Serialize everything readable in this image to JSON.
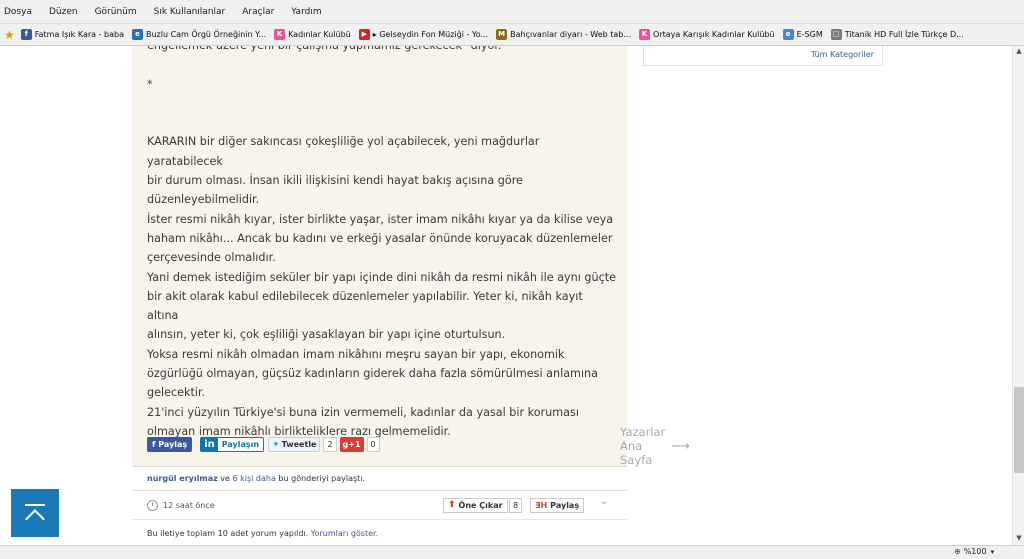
{
  "menu": [
    "Dosya",
    "Düzen",
    "Görünüm",
    "Sık Kullanılanlar",
    "Araçlar",
    "Yardım"
  ],
  "bookmarks": [
    {
      "label": "Fatma Işık Kara - baba",
      "icon": "facebook-icon",
      "color": "#3b5998",
      "glyph": "f"
    },
    {
      "label": "Buzlu Cam Örgü Örneğinin Y...",
      "icon": "globe-icon",
      "color": "#2a6fb3",
      "glyph": "e"
    },
    {
      "label": "Kadınlar Kulübü",
      "icon": "kadinlar-kulubu-icon",
      "color": "#e8559a",
      "glyph": "K"
    },
    {
      "label": "▸ Gelseydin Fon Müziği - Yo...",
      "icon": "youtube-icon",
      "color": "#d62222",
      "glyph": "▶"
    },
    {
      "label": "Bahçıvanlar diyarı - Web tab...",
      "icon": "bahcivanlar-icon",
      "color": "#8b6a1a",
      "glyph": "M"
    },
    {
      "label": "Ortaya Karışık Kadınlar Kulübü",
      "icon": "kadinlar-kulubu-icon",
      "color": "#e8559a",
      "glyph": "K"
    },
    {
      "label": "E-SGM",
      "icon": "ie-page-icon",
      "color": "#4a88c8",
      "glyph": "e"
    },
    {
      "label": "Titanik HD Full İzle Türkçe D...",
      "icon": "page-icon",
      "color": "#7a7a7a",
      "glyph": "□"
    }
  ],
  "sidebar": {
    "all_categories": "Tüm Kategoriler"
  },
  "article": {
    "paragraphs": [
      "engellemek üzere yeni bir çalışma yapmamız gerekecek\" diyor.",
      "",
      "*",
      "",
      "",
      "KARARIN bir diğer sakıncası çokeşliliğe yol açabilecek, yeni mağdurlar yaratabilecek",
      "bir durum olması. İnsan ikili ilişkisini kendi hayat bakış açısına göre",
      "düzenleyebilmelidir.",
      "İster resmi nikâh kıyar, ister birlikte yaşar, ister imam nikâhı kıyar ya da kilise veya",
      "haham nikâhı... Ancak bu kadını ve erkeği yasalar önünde koruyacak düzenlemeler",
      "çerçevesinde olmalıdır.",
      "Yani demek istediğim seküler bir yapı içinde dini nikâh da resmi nikâh ile aynı güçte",
      "bir akit olarak kabul edilebilecek düzenlemeler yapılabilir. Yeter ki, nikâh kayıt altına",
      "alınsın, yeter ki, çok eşliliği yasaklayan bir yapı içine oturtulsun.",
      "Yoksa resmi nikâh olmadan imam nikâhını meşru sayan bir yapı, ekonomik",
      "özgürlüğü olmayan, güçsüz kadınların giderek daha fazla sömürülmesi anlamına",
      "gelecektir.",
      "21'inci yüzyılın Türkiye'si buna izin vermemeli, kadınlar da yasal bir koruması",
      "olmayan imam nikâhlı birlikteliklere razı gelmemelidir."
    ],
    "share": {
      "facebook": "Paylaş",
      "linkedin_logo": "in",
      "linkedin": "Paylaşın",
      "tweet": "Tweetle",
      "tweet_count": "2",
      "gplus": "g+1",
      "gplus_count": "0"
    },
    "authors_link": "Yazarlar Ana Sayfa"
  },
  "shared_line": {
    "name": "nurgül eryılmaz",
    "mid": " ve ",
    "others": "6 kişi daha",
    "tail": " bu gönderiyi paylaştı."
  },
  "actions": {
    "time": "12 saat önce",
    "upvote": "Öne Çıkar",
    "upvote_count": "8",
    "share": "Paylaş"
  },
  "comments": {
    "text": "Bu iletiye toplam 10 adet yorum yapıldı. ",
    "link": "Yorumları göster."
  },
  "status": {
    "zoom": "%100"
  }
}
